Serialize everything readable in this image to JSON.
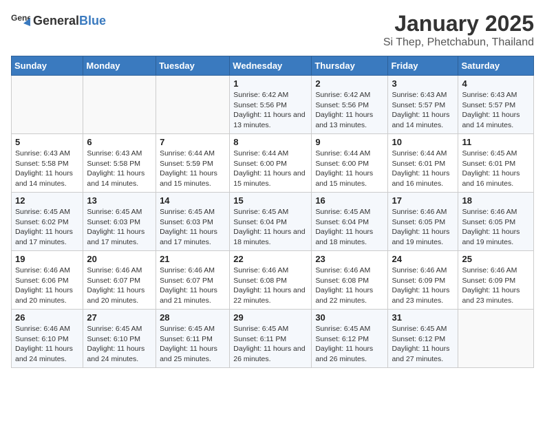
{
  "header": {
    "logo_general": "General",
    "logo_blue": "Blue",
    "title": "January 2025",
    "subtitle": "Si Thep, Phetchabun, Thailand"
  },
  "weekdays": [
    "Sunday",
    "Monday",
    "Tuesday",
    "Wednesday",
    "Thursday",
    "Friday",
    "Saturday"
  ],
  "weeks": [
    [
      {
        "day": "",
        "sunrise": "",
        "sunset": "",
        "daylight": ""
      },
      {
        "day": "",
        "sunrise": "",
        "sunset": "",
        "daylight": ""
      },
      {
        "day": "",
        "sunrise": "",
        "sunset": "",
        "daylight": ""
      },
      {
        "day": "1",
        "sunrise": "Sunrise: 6:42 AM",
        "sunset": "Sunset: 5:56 PM",
        "daylight": "Daylight: 11 hours and 13 minutes."
      },
      {
        "day": "2",
        "sunrise": "Sunrise: 6:42 AM",
        "sunset": "Sunset: 5:56 PM",
        "daylight": "Daylight: 11 hours and 13 minutes."
      },
      {
        "day": "3",
        "sunrise": "Sunrise: 6:43 AM",
        "sunset": "Sunset: 5:57 PM",
        "daylight": "Daylight: 11 hours and 14 minutes."
      },
      {
        "day": "4",
        "sunrise": "Sunrise: 6:43 AM",
        "sunset": "Sunset: 5:57 PM",
        "daylight": "Daylight: 11 hours and 14 minutes."
      }
    ],
    [
      {
        "day": "5",
        "sunrise": "Sunrise: 6:43 AM",
        "sunset": "Sunset: 5:58 PM",
        "daylight": "Daylight: 11 hours and 14 minutes."
      },
      {
        "day": "6",
        "sunrise": "Sunrise: 6:43 AM",
        "sunset": "Sunset: 5:58 PM",
        "daylight": "Daylight: 11 hours and 14 minutes."
      },
      {
        "day": "7",
        "sunrise": "Sunrise: 6:44 AM",
        "sunset": "Sunset: 5:59 PM",
        "daylight": "Daylight: 11 hours and 15 minutes."
      },
      {
        "day": "8",
        "sunrise": "Sunrise: 6:44 AM",
        "sunset": "Sunset: 6:00 PM",
        "daylight": "Daylight: 11 hours and 15 minutes."
      },
      {
        "day": "9",
        "sunrise": "Sunrise: 6:44 AM",
        "sunset": "Sunset: 6:00 PM",
        "daylight": "Daylight: 11 hours and 15 minutes."
      },
      {
        "day": "10",
        "sunrise": "Sunrise: 6:44 AM",
        "sunset": "Sunset: 6:01 PM",
        "daylight": "Daylight: 11 hours and 16 minutes."
      },
      {
        "day": "11",
        "sunrise": "Sunrise: 6:45 AM",
        "sunset": "Sunset: 6:01 PM",
        "daylight": "Daylight: 11 hours and 16 minutes."
      }
    ],
    [
      {
        "day": "12",
        "sunrise": "Sunrise: 6:45 AM",
        "sunset": "Sunset: 6:02 PM",
        "daylight": "Daylight: 11 hours and 17 minutes."
      },
      {
        "day": "13",
        "sunrise": "Sunrise: 6:45 AM",
        "sunset": "Sunset: 6:03 PM",
        "daylight": "Daylight: 11 hours and 17 minutes."
      },
      {
        "day": "14",
        "sunrise": "Sunrise: 6:45 AM",
        "sunset": "Sunset: 6:03 PM",
        "daylight": "Daylight: 11 hours and 17 minutes."
      },
      {
        "day": "15",
        "sunrise": "Sunrise: 6:45 AM",
        "sunset": "Sunset: 6:04 PM",
        "daylight": "Daylight: 11 hours and 18 minutes."
      },
      {
        "day": "16",
        "sunrise": "Sunrise: 6:45 AM",
        "sunset": "Sunset: 6:04 PM",
        "daylight": "Daylight: 11 hours and 18 minutes."
      },
      {
        "day": "17",
        "sunrise": "Sunrise: 6:46 AM",
        "sunset": "Sunset: 6:05 PM",
        "daylight": "Daylight: 11 hours and 19 minutes."
      },
      {
        "day": "18",
        "sunrise": "Sunrise: 6:46 AM",
        "sunset": "Sunset: 6:05 PM",
        "daylight": "Daylight: 11 hours and 19 minutes."
      }
    ],
    [
      {
        "day": "19",
        "sunrise": "Sunrise: 6:46 AM",
        "sunset": "Sunset: 6:06 PM",
        "daylight": "Daylight: 11 hours and 20 minutes."
      },
      {
        "day": "20",
        "sunrise": "Sunrise: 6:46 AM",
        "sunset": "Sunset: 6:07 PM",
        "daylight": "Daylight: 11 hours and 20 minutes."
      },
      {
        "day": "21",
        "sunrise": "Sunrise: 6:46 AM",
        "sunset": "Sunset: 6:07 PM",
        "daylight": "Daylight: 11 hours and 21 minutes."
      },
      {
        "day": "22",
        "sunrise": "Sunrise: 6:46 AM",
        "sunset": "Sunset: 6:08 PM",
        "daylight": "Daylight: 11 hours and 22 minutes."
      },
      {
        "day": "23",
        "sunrise": "Sunrise: 6:46 AM",
        "sunset": "Sunset: 6:08 PM",
        "daylight": "Daylight: 11 hours and 22 minutes."
      },
      {
        "day": "24",
        "sunrise": "Sunrise: 6:46 AM",
        "sunset": "Sunset: 6:09 PM",
        "daylight": "Daylight: 11 hours and 23 minutes."
      },
      {
        "day": "25",
        "sunrise": "Sunrise: 6:46 AM",
        "sunset": "Sunset: 6:09 PM",
        "daylight": "Daylight: 11 hours and 23 minutes."
      }
    ],
    [
      {
        "day": "26",
        "sunrise": "Sunrise: 6:46 AM",
        "sunset": "Sunset: 6:10 PM",
        "daylight": "Daylight: 11 hours and 24 minutes."
      },
      {
        "day": "27",
        "sunrise": "Sunrise: 6:45 AM",
        "sunset": "Sunset: 6:10 PM",
        "daylight": "Daylight: 11 hours and 24 minutes."
      },
      {
        "day": "28",
        "sunrise": "Sunrise: 6:45 AM",
        "sunset": "Sunset: 6:11 PM",
        "daylight": "Daylight: 11 hours and 25 minutes."
      },
      {
        "day": "29",
        "sunrise": "Sunrise: 6:45 AM",
        "sunset": "Sunset: 6:11 PM",
        "daylight": "Daylight: 11 hours and 26 minutes."
      },
      {
        "day": "30",
        "sunrise": "Sunrise: 6:45 AM",
        "sunset": "Sunset: 6:12 PM",
        "daylight": "Daylight: 11 hours and 26 minutes."
      },
      {
        "day": "31",
        "sunrise": "Sunrise: 6:45 AM",
        "sunset": "Sunset: 6:12 PM",
        "daylight": "Daylight: 11 hours and 27 minutes."
      },
      {
        "day": "",
        "sunrise": "",
        "sunset": "",
        "daylight": ""
      }
    ]
  ]
}
